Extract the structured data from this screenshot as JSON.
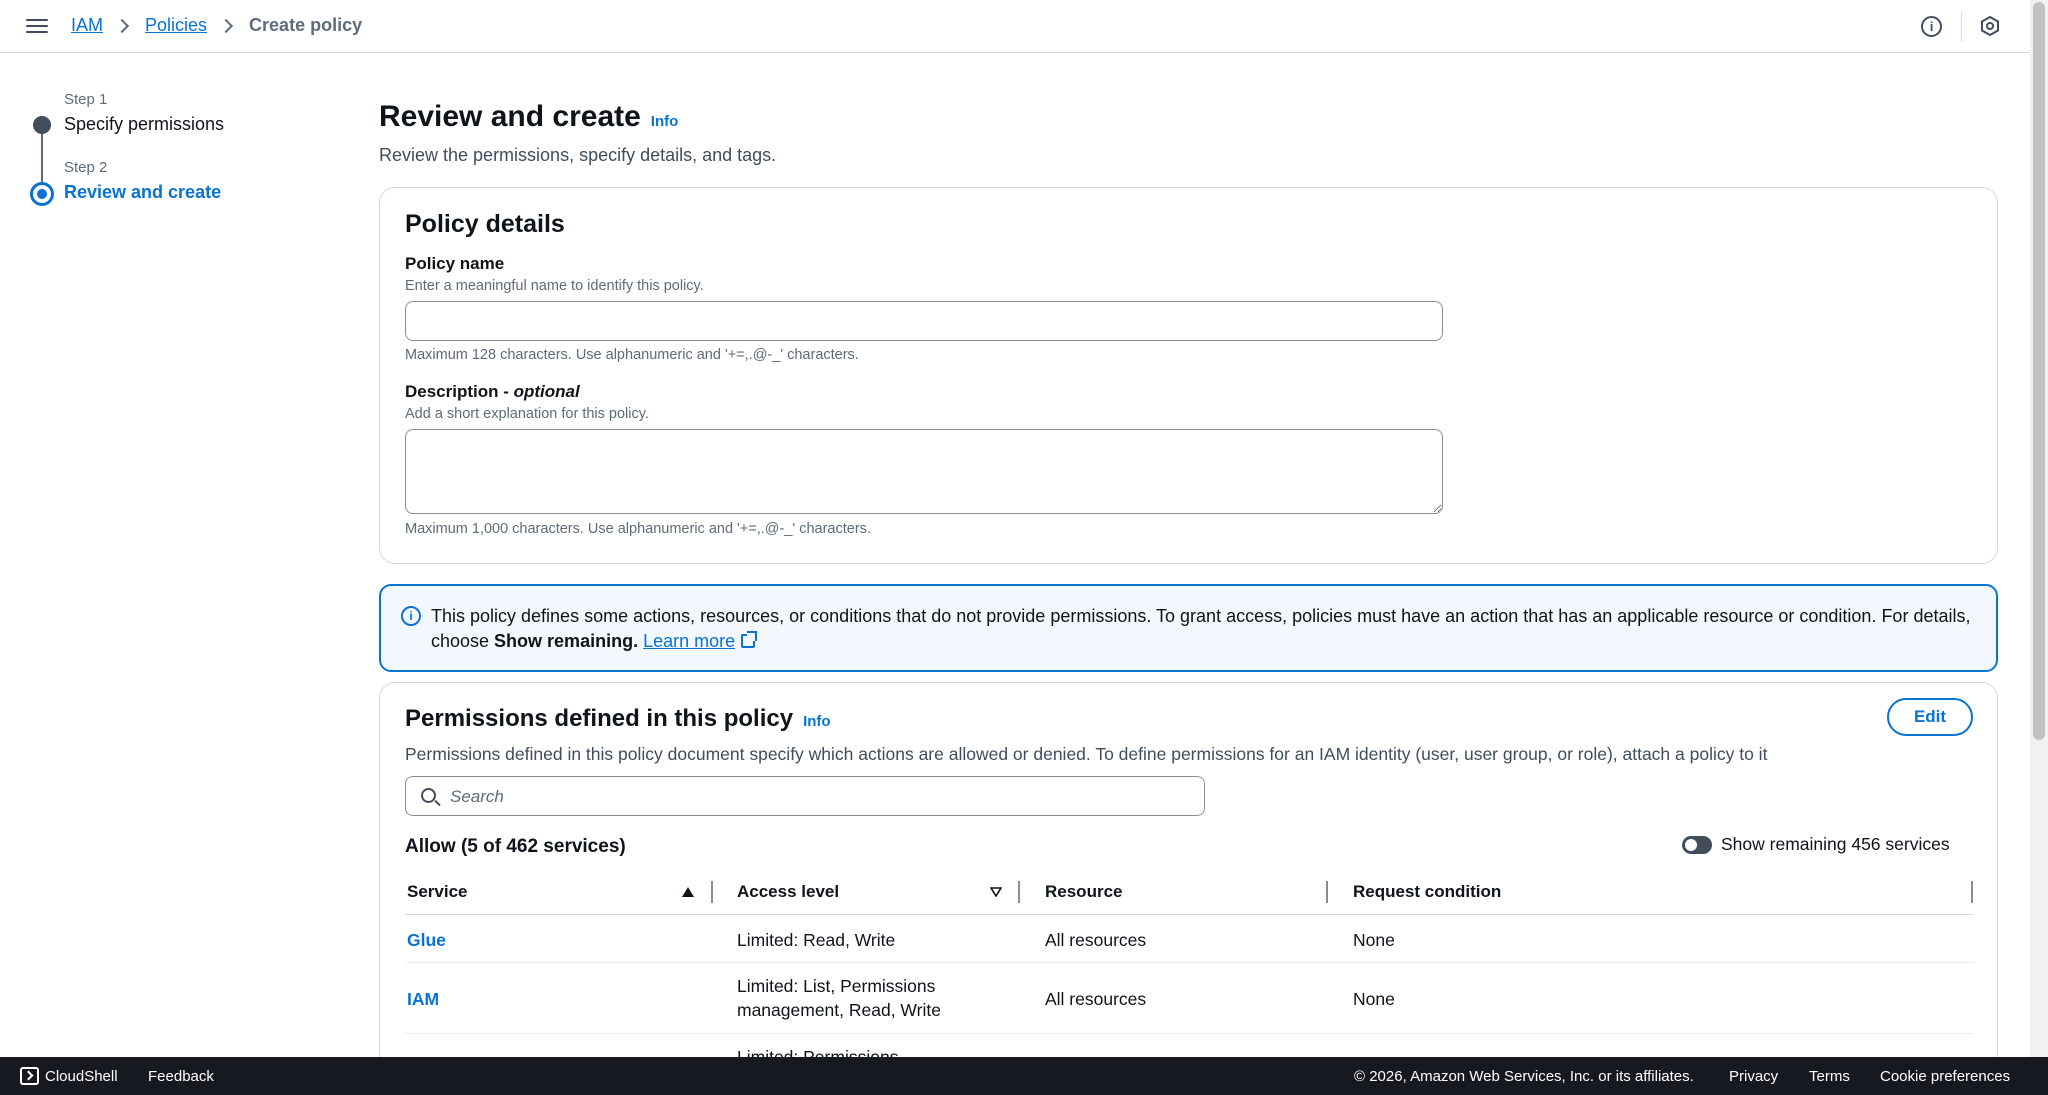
{
  "breadcrumb": {
    "root": "IAM",
    "section": "Policies",
    "current": "Create policy"
  },
  "icons": {
    "menu": "hamburger-icon",
    "help": "info-icon",
    "settings": "settings-hex-icon"
  },
  "steps": [
    {
      "number": "Step 1",
      "label": "Specify permissions"
    },
    {
      "number": "Step 2",
      "label": "Review and create"
    }
  ],
  "page": {
    "title": "Review and create",
    "info": "Info",
    "description": "Review the permissions, specify details, and tags."
  },
  "policy_details": {
    "title": "Policy details",
    "name_label": "Policy name",
    "name_desc": "Enter a meaningful name to identify this policy.",
    "name_value": "",
    "name_hint": "Maximum 128 characters. Use alphanumeric and '+=,.@-_' characters.",
    "desc_label": "Description - ",
    "desc_optional": "optional",
    "desc_desc": "Add a short explanation for this policy.",
    "desc_value": "",
    "desc_hint": "Maximum 1,000 characters. Use alphanumeric and '+=,.@-_' characters."
  },
  "alert": {
    "text_before": "This policy defines some actions, resources, or conditions that do not provide permissions. To grant access, policies must have an action that has an applicable resource or condition. For details, choose ",
    "bold": "Show remaining.",
    "link": "Learn more"
  },
  "permissions": {
    "title": "Permissions defined in this policy",
    "info": "Info",
    "edit_label": "Edit",
    "description": "Permissions defined in this policy document specify which actions are allowed or denied. To define permissions for an IAM identity (user, user group, or role), attach a policy to it",
    "search_placeholder": "Search",
    "allow_heading": "Allow (5 of 462 services)",
    "toggle_label": "Show remaining 456 services",
    "toggle_on": false,
    "columns": [
      "Service",
      "Access level",
      "Resource",
      "Request condition"
    ],
    "rows": [
      {
        "service": "Glue",
        "access_line1": "Limited: Read, Write",
        "access_line2": "",
        "resource": "All resources",
        "condition": "None"
      },
      {
        "service": "IAM",
        "access_line1": "Limited: List, Permissions",
        "access_line2": "management, Read, Write",
        "resource": "All resources",
        "condition": "None"
      },
      {
        "service": "",
        "access_line1": "Limited: Permissions",
        "access_line2": "",
        "resource": "",
        "condition": ""
      }
    ]
  },
  "footer": {
    "cloudshell": "CloudShell",
    "feedback": "Feedback",
    "copyright": "© 2026, Amazon Web Services, Inc. or its affiliates.",
    "privacy": "Privacy",
    "terms": "Terms",
    "cookies": "Cookie preferences"
  },
  "colors": {
    "link": "#0972d3",
    "text": "#0f141a",
    "footer_bg": "#16191f",
    "alert_bg": "#f2f8fd"
  }
}
